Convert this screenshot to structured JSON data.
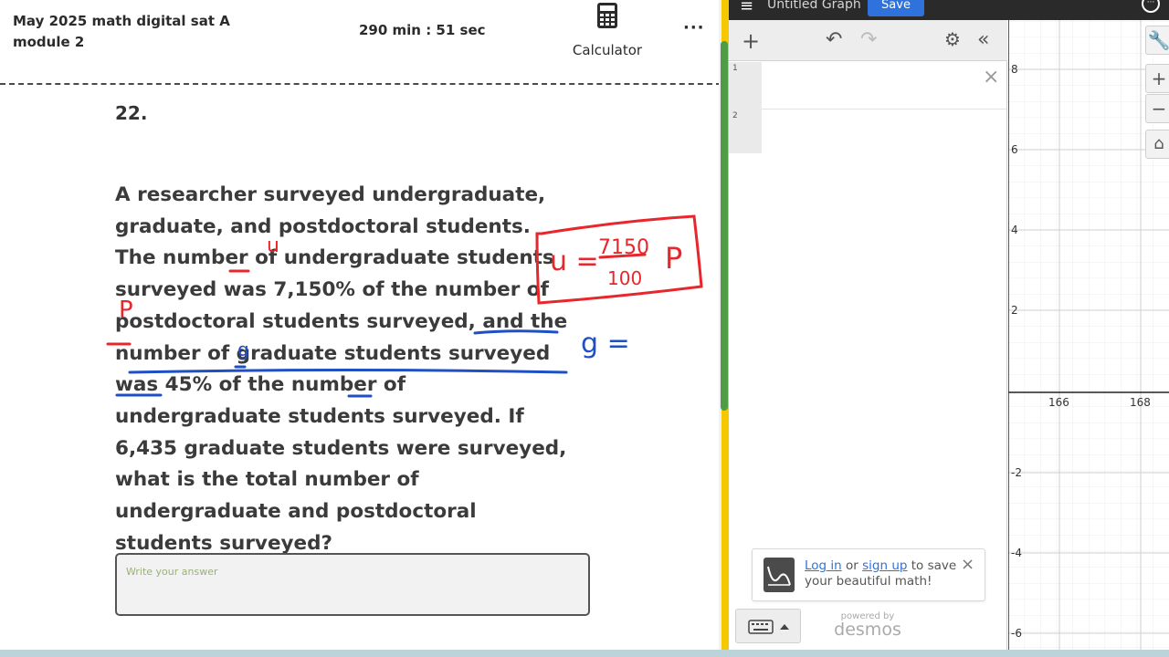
{
  "header": {
    "exam_title": "May 2025 math digital sat A module 2",
    "timer": "290 min : 51 sec",
    "calculator_label": "Calculator",
    "more_label": "···"
  },
  "question": {
    "number": "22.",
    "text": "A researcher surveyed undergraduate, graduate, and postdoctoral students. The number of undergraduate students surveyed was 7,150% of the number of postdoctoral students surveyed, and the number of graduate students surveyed was 45% of the number of undergraduate students surveyed. If 6,435 graduate students were surveyed, what is the total number of undergraduate and postdoctoral students surveyed?",
    "answer_placeholder": "Write your answer"
  },
  "annotations": {
    "u_letter": "u",
    "p_letter": "P",
    "g_letter": "g",
    "box_u": "u =",
    "box_num": "7150",
    "box_den": "100",
    "box_p": "P",
    "g_equals": "g ="
  },
  "desmos": {
    "menu_icon": "hamburger-icon",
    "graph_title": "Untitled Graph",
    "save_label": "Save",
    "toolbar": {
      "add": "+",
      "undo": "↶",
      "redo": "↷",
      "settings": "⚙",
      "collapse": "«"
    },
    "expressions": [
      "1",
      "2"
    ],
    "close": "×",
    "login": {
      "log_in": "Log in",
      "or": " or ",
      "sign_up": "sign up",
      "rest": " to save your beautiful math!",
      "close": "×"
    },
    "powered_by": "powered by",
    "logo": "desmos",
    "graph": {
      "y_ticks": [
        "8",
        "6",
        "4",
        "2",
        "-2",
        "-4",
        "-6"
      ],
      "x_ticks": [
        "166",
        "168"
      ]
    },
    "graph_tools": [
      "wrench-icon",
      "zoom-in-icon",
      "zoom-out-icon",
      "home-icon"
    ],
    "graph_tool_labels": {
      "wrench": "🔧",
      "plus": "+",
      "minus": "−",
      "home": "⌂"
    }
  },
  "colors": {
    "annotation_red": "#e8262b",
    "annotation_blue": "#1f4fc4",
    "save_blue": "#2f72dc",
    "yellow": "#f5c800",
    "scroll_green": "#4f9c47"
  }
}
